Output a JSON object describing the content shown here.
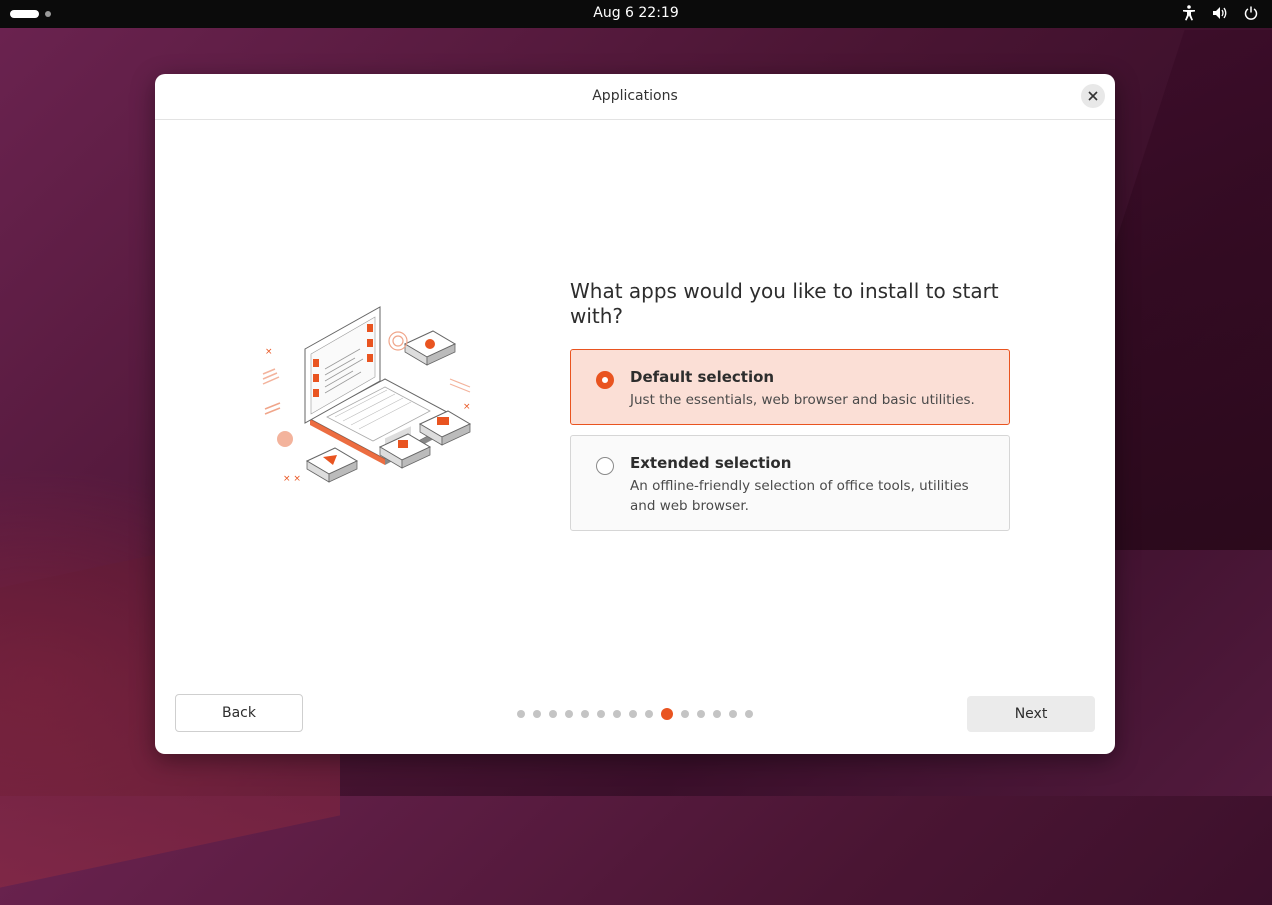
{
  "topbar": {
    "clock": "Aug 6  22:19",
    "icons": [
      "activities-pill",
      "workspace-dot",
      "accessibility-icon",
      "volume-icon",
      "power-icon"
    ]
  },
  "window": {
    "title": "Applications",
    "question": "What apps would you like to install to start with?",
    "options": [
      {
        "title": "Default selection",
        "description": "Just the essentials, web browser and basic utilities.",
        "selected": true
      },
      {
        "title": "Extended selection",
        "description": "An offline-friendly selection of office tools, utilities and web browser.",
        "selected": false
      }
    ],
    "back_label": "Back",
    "next_label": "Next",
    "pager": {
      "total": 15,
      "current": 10
    }
  },
  "colors": {
    "accent": "#e95420",
    "selected_bg": "#fbdfd6",
    "topbar": "#0b0b0b"
  }
}
